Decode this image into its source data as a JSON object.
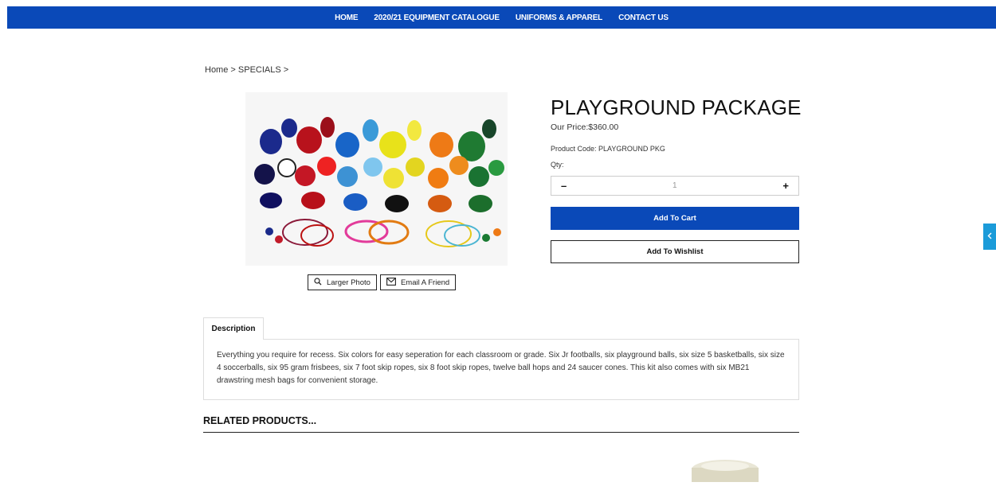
{
  "nav": {
    "items": [
      {
        "label": "HOME"
      },
      {
        "label": "2020/21 EQUIPMENT CATALOGUE"
      },
      {
        "label": "UNIFORMS & APPAREL"
      },
      {
        "label": "CONTACT US"
      }
    ]
  },
  "breadcrumb": {
    "home": "Home",
    "separator": ">",
    "category": "SPECIALS"
  },
  "product": {
    "title": "PLAYGROUND PACKAGE",
    "price": "Our Price:$360.00",
    "code": "Product Code: PLAYGROUND PKG",
    "qty_label": "Qty:",
    "qty_value": "1",
    "qty_minus": "–",
    "qty_plus": "+",
    "add_to_cart": "Add To Cart",
    "add_to_wishlist": "Add To Wishlist"
  },
  "image_actions": {
    "larger_photo": "Larger Photo",
    "email_friend": "Email A Friend"
  },
  "tabs": {
    "description_label": "Description",
    "description_text": "Everything you require for recess. Six colors for easy seperation for each classroom or grade. Six Jr footballs, six playground balls, six size 5 basketballs, six size 4 soccerballs, six 95 gram frisbees, six 7 foot skip ropes, six 8 foot skip ropes, twelve ball hops and 24 saucer cones.  This kit also comes with six MB21 drawstring mesh bags for convenient storage."
  },
  "related": {
    "title": "RELATED PRODUCTS..."
  },
  "side_tab": {
    "icon": "chevron-left-icon"
  },
  "colors": {
    "brand_blue": "#0a49b8",
    "side_tab": "#1b9bd9"
  }
}
